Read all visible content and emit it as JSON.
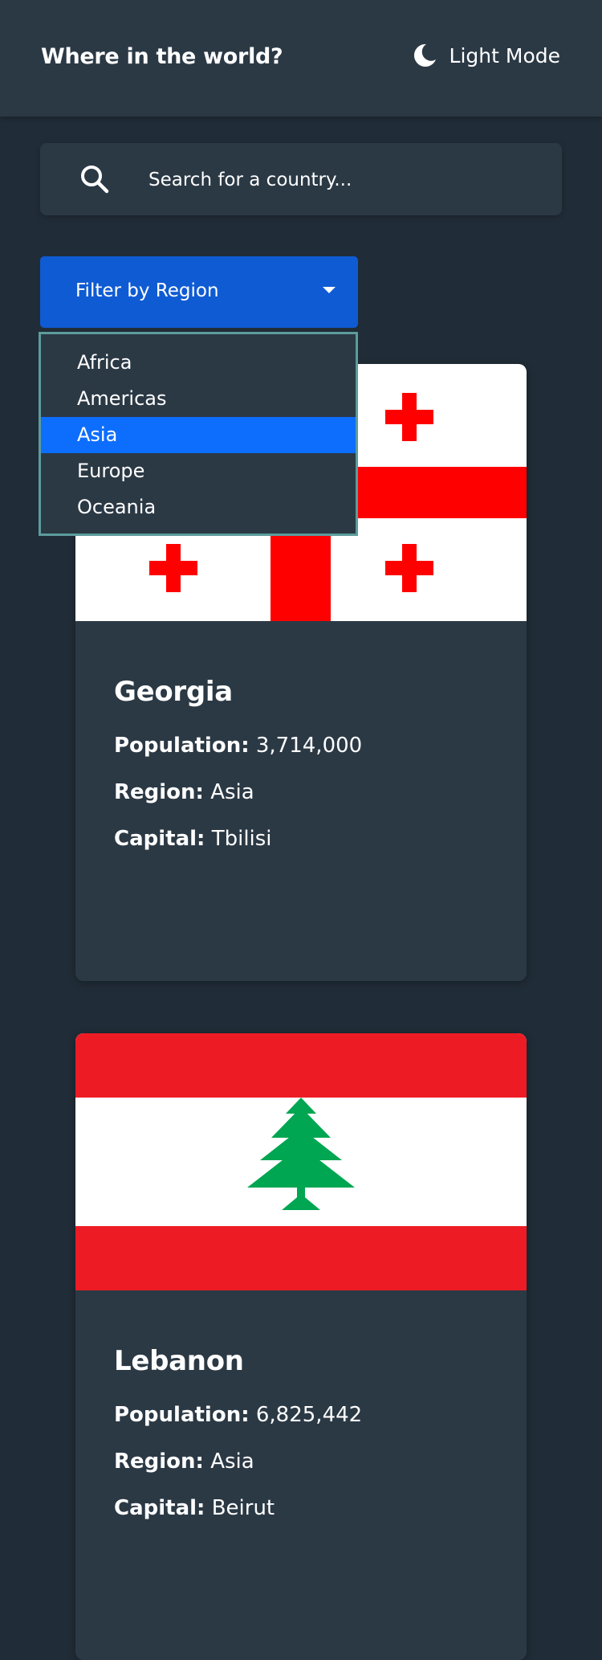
{
  "header": {
    "title": "Where in the world?",
    "mode_label": "Light Mode",
    "mode_icon": "moon-icon"
  },
  "search": {
    "placeholder": "Search for a country...",
    "value": "",
    "icon": "search-icon"
  },
  "filter": {
    "label": "Filter by Region",
    "options": [
      "Africa",
      "Americas",
      "Asia",
      "Europe",
      "Oceania"
    ],
    "selected": "Asia"
  },
  "countries": [
    {
      "name": "Georgia",
      "population_label": "Population:",
      "population": "3,714,000",
      "region_label": "Region:",
      "region": "Asia",
      "capital_label": "Capital:",
      "capital": "Tbilisi"
    },
    {
      "name": "Lebanon",
      "population_label": "Population:",
      "population": "6,825,442",
      "region_label": "Region:",
      "region": "Asia",
      "capital_label": "Capital:",
      "capital": "Beirut"
    }
  ],
  "colors": {
    "background": "#202c37",
    "element": "#2b3945",
    "filter": "#0f5bd3",
    "selected_option": "#0d6efd"
  }
}
